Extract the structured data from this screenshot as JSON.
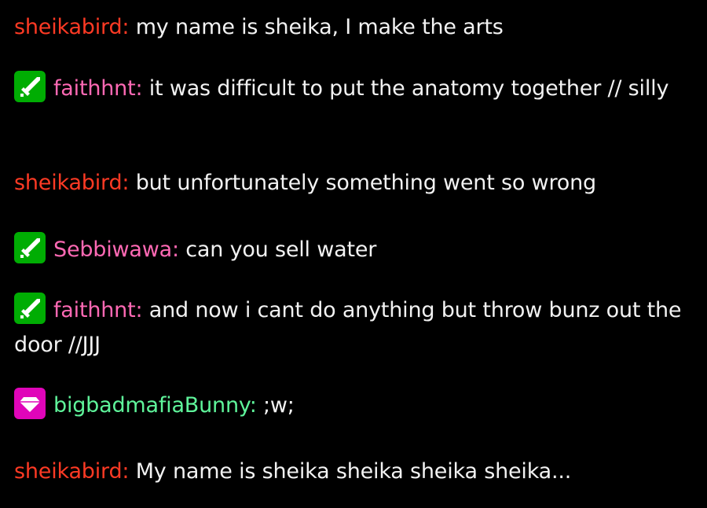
{
  "colors": {
    "background": "#000000",
    "message_text": "#f2f2f2",
    "moderator_badge": "#00ad03",
    "vip_badge": "#e005b9"
  },
  "messages": [
    {
      "badge": null,
      "username": "sheikabird",
      "username_color": "#ff3a24",
      "separator": ":",
      "text": " my name is sheika, I make the arts"
    },
    {
      "badge": "sword-icon",
      "username": "faithhnt",
      "username_color": "#ff69b4",
      "separator": ":",
      "text": " it was difficult to put the anatomy together // silly"
    },
    {
      "badge": null,
      "username": "sheikabird",
      "username_color": "#ff3a24",
      "separator": ":",
      "text": " but unfortunately something went so wrong"
    },
    {
      "badge": "sword-icon",
      "username": "Sebbiwawa",
      "username_color": "#ff69b4",
      "separator": ":",
      "text": " can you sell water"
    },
    {
      "badge": "sword-icon",
      "username": "faithhnt",
      "username_color": "#ff69b4",
      "separator": ":",
      "text": " and now i cant do anything but throw bunz out the door //JJJ"
    },
    {
      "badge": "diamond-icon",
      "username": "bigbadmafiaBunny",
      "username_color": "#5ff59b",
      "separator": ":",
      "text": " ;w;"
    },
    {
      "badge": null,
      "username": "sheikabird",
      "username_color": "#ff3a24",
      "separator": ":",
      "text": " My name is sheika sheika sheika sheika..."
    }
  ]
}
